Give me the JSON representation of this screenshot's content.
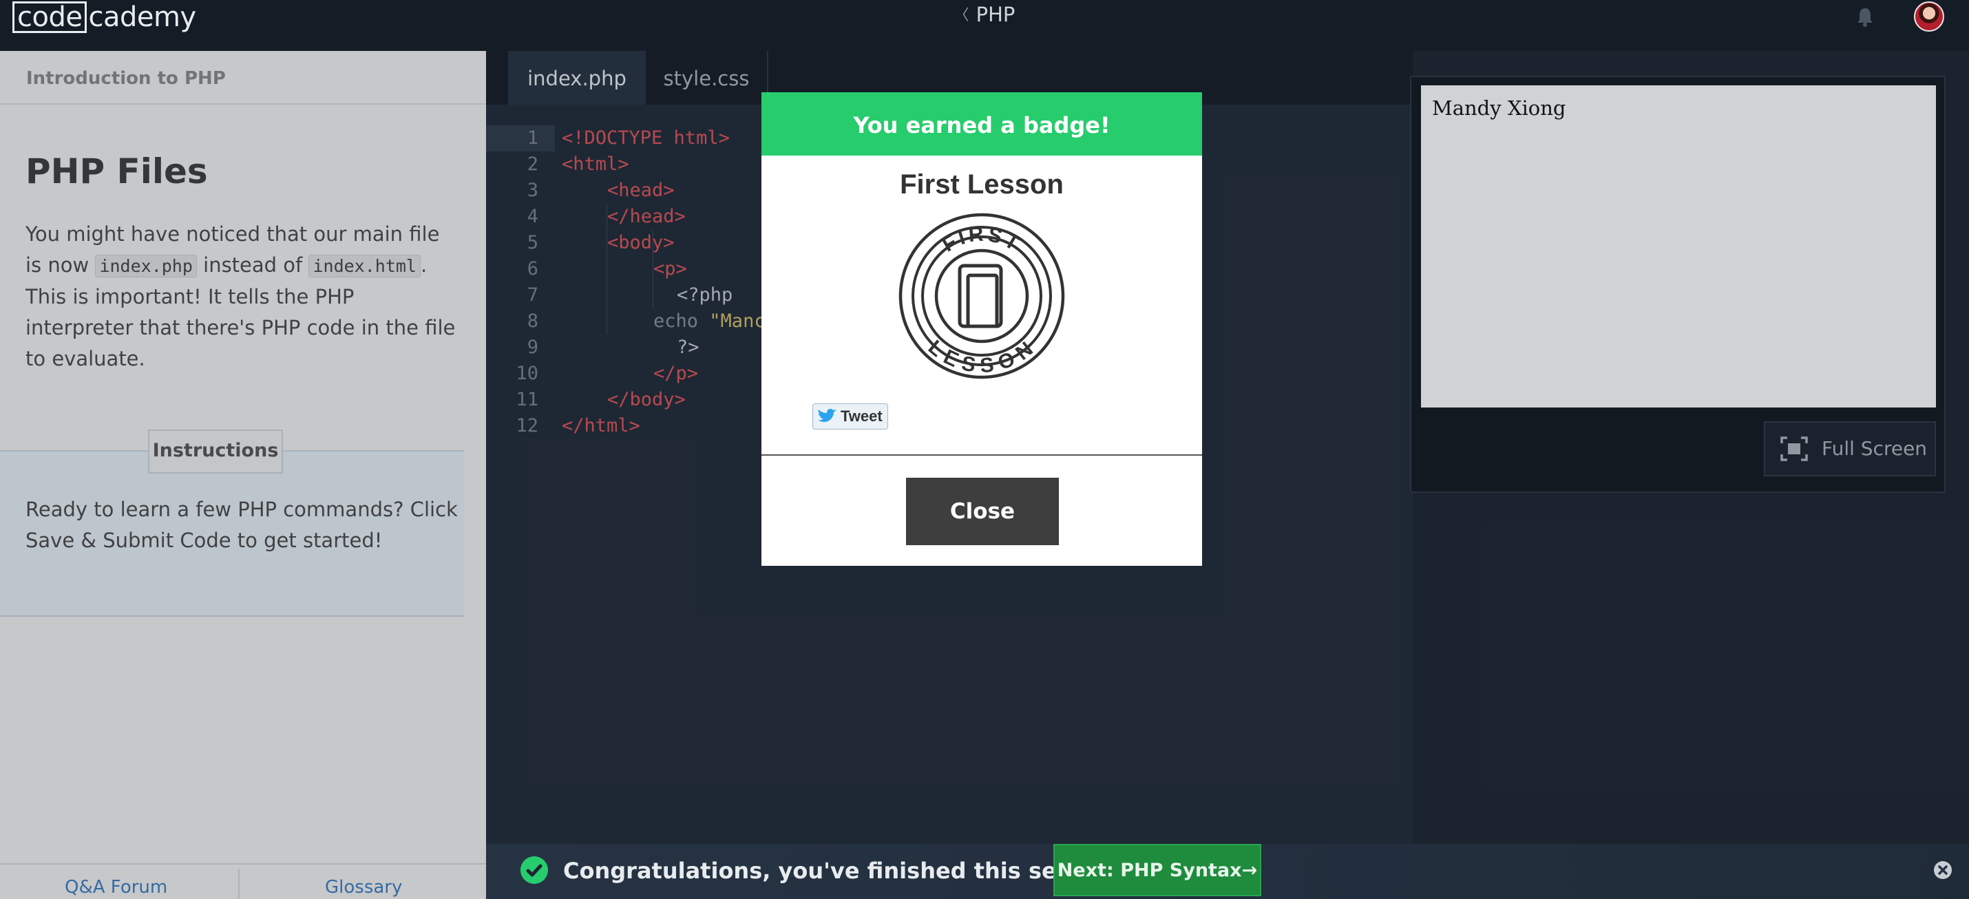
{
  "nav": {
    "logo_boxed": "code",
    "logo_rest": "cademy",
    "back_chevron": "〈",
    "course_title": "PHP"
  },
  "lesson": {
    "header": "Introduction to PHP",
    "title": "PHP Files",
    "body": {
      "p1": "You might have noticed that our main file is now ",
      "code1": "index.php",
      "p2": " instead of ",
      "code2": "index.html",
      "p3": ". This is important! It tells the PHP interpreter that there's PHP code in the file to evaluate."
    },
    "instructions_tab": "Instructions",
    "instructions_text": "Ready to learn a few PHP commands? Click Save & Submit Code to get started!",
    "footer": {
      "qa": "Q&A Forum",
      "glossary": "Glossary"
    }
  },
  "editor": {
    "tabs": [
      "index.php",
      "style.css"
    ],
    "line_numbers": [
      "1",
      "2",
      "3",
      "4",
      "5",
      "6",
      "7",
      "8",
      "9",
      "10",
      "11",
      "12"
    ],
    "lines": [
      "<!DOCTYPE html>",
      "<html>",
      "<head>",
      "</head>",
      "<body>",
      "<p>",
      "<?php",
      "echo",
      "\"Manc",
      "?>",
      "</p>",
      "</body>",
      "</html>"
    ]
  },
  "preview": {
    "output_text": "Mandy Xiong",
    "fullscreen_label": "Full Screen"
  },
  "modal": {
    "header": "You earned a badge!",
    "badge_title": "First Lesson",
    "badge_top_text": "FIRST",
    "badge_bottom_text": "LESSON",
    "tweet_label": "Tweet",
    "close_label": "Close"
  },
  "notification": {
    "message": "Congratulations, you've finished this section!",
    "next_label": "Next: PHP Syntax→"
  },
  "colors": {
    "accent_green": "#27cc6d",
    "next_button_green": "#1f8b3d",
    "nav_bg": "#141c26",
    "editor_bg": "#202b37",
    "tag_red": "#e0545b"
  },
  "icons": [
    "bell-icon",
    "avatar",
    "badge-book-icon",
    "twitter-bird-icon",
    "fullscreen-icon",
    "check-icon",
    "close-circle-icon"
  ]
}
